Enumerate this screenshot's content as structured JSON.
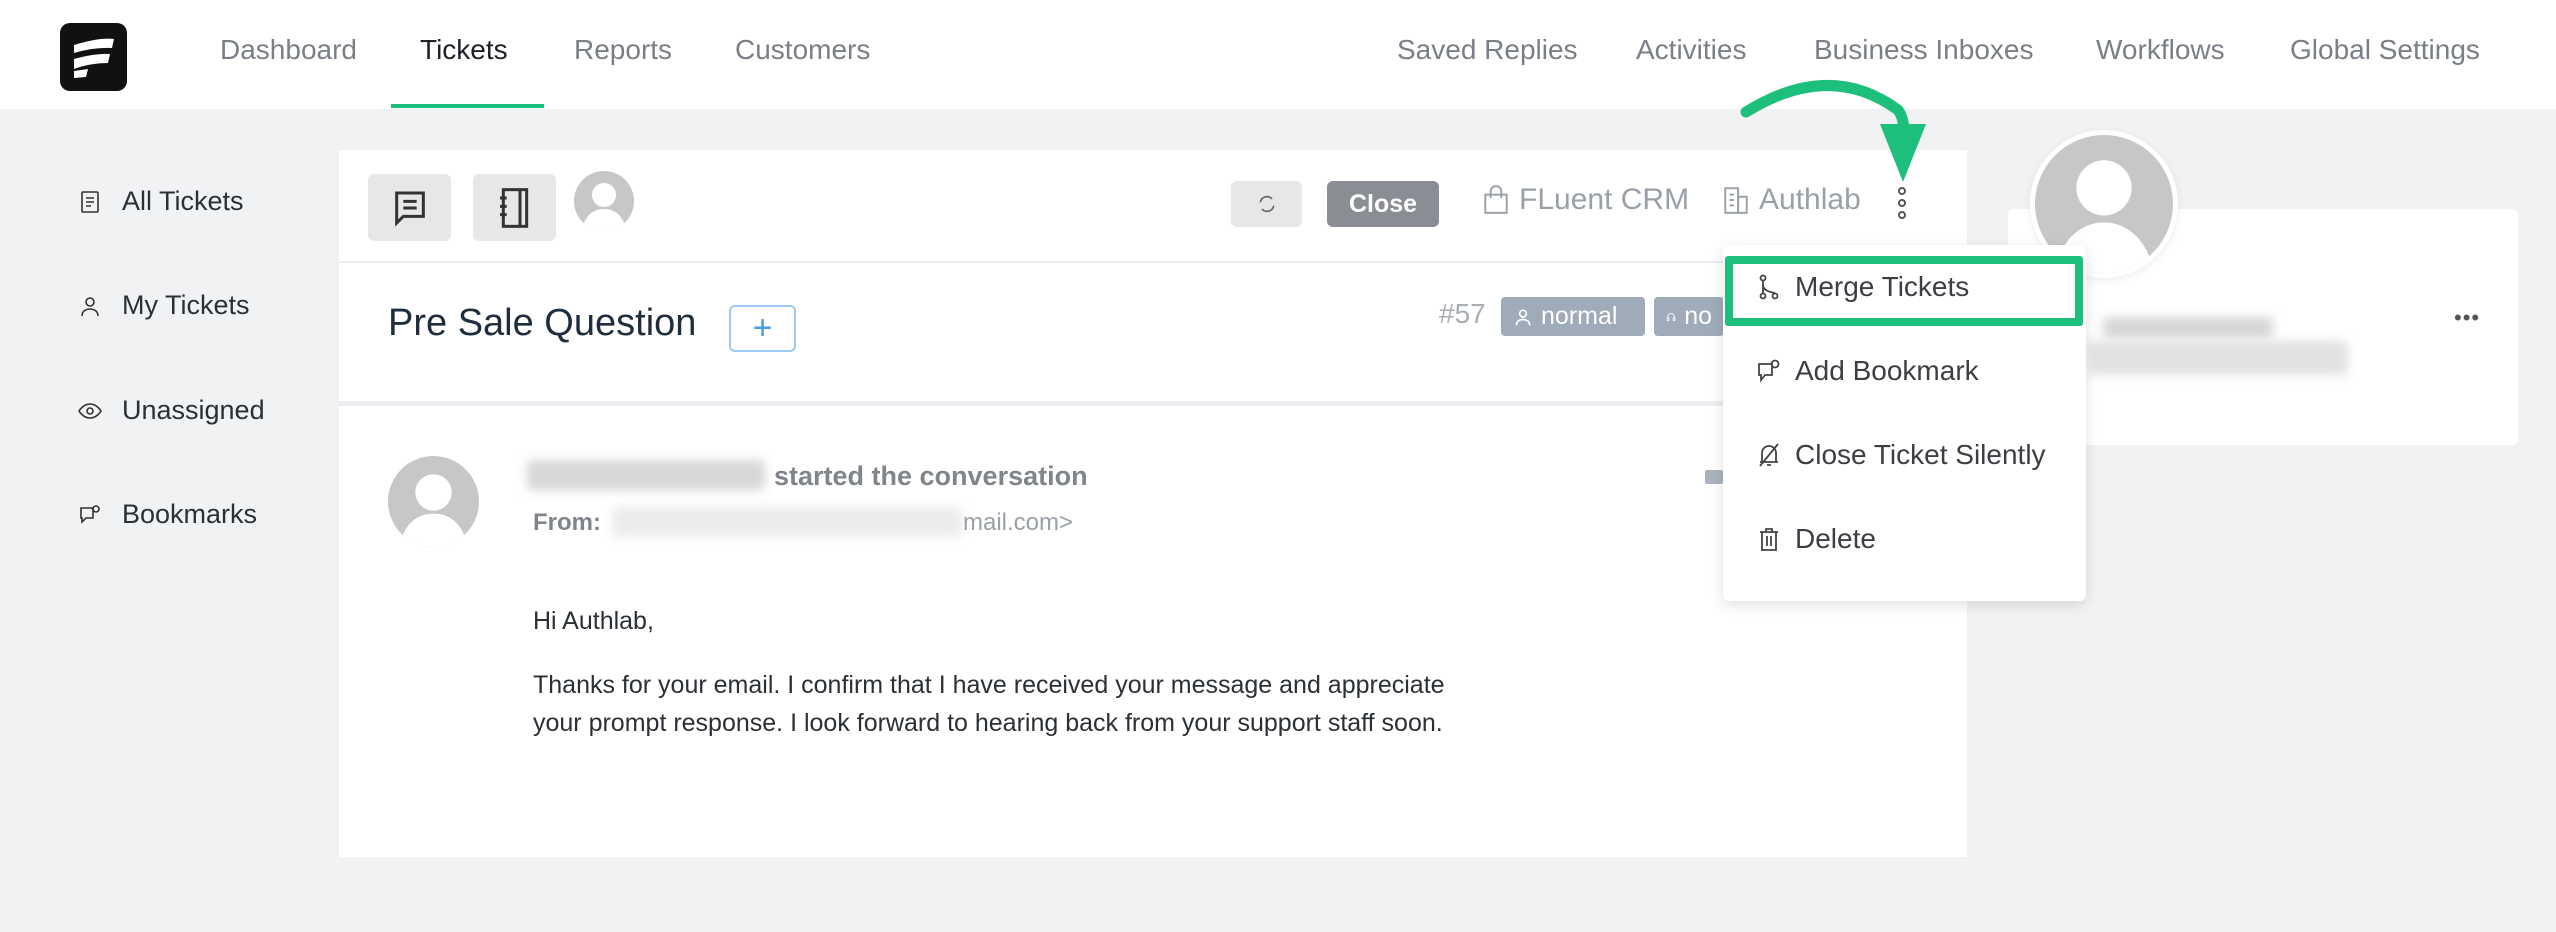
{
  "nav": {
    "left": [
      "Dashboard",
      "Tickets",
      "Reports",
      "Customers"
    ],
    "active": "Tickets",
    "right": [
      "Saved Replies",
      "Activities",
      "Business Inboxes",
      "Workflows",
      "Global Settings"
    ]
  },
  "sidebar": {
    "items": [
      {
        "label": "All Tickets",
        "icon": "document-icon"
      },
      {
        "label": "My Tickets",
        "icon": "user-icon"
      },
      {
        "label": "Unassigned",
        "icon": "eye-icon"
      },
      {
        "label": "Bookmarks",
        "icon": "bookmark-chat-icon"
      }
    ]
  },
  "toolbar": {
    "close_label": "Close",
    "product": "FLuent CRM",
    "business": "Authlab"
  },
  "ticket": {
    "title": "Pre Sale Question",
    "number": "#57",
    "priority": "normal",
    "second_badge": "no"
  },
  "conversation": {
    "action": "started the conversation",
    "from_label": "From:",
    "email_suffix": "mail.com>",
    "greeting": "Hi Authlab,",
    "body": "Thanks for your email. I confirm that I have received your message and appreciate your prompt response. I look forward to hearing back from your support staff soon."
  },
  "menu": {
    "items": [
      "Merge Tickets",
      "Add Bookmark",
      "Close Ticket Silently",
      "Delete"
    ],
    "highlighted": "Merge Tickets"
  },
  "colors": {
    "accent": "#1dbf7c",
    "badge": "#9fabb8",
    "close_button": "#8a8d93"
  }
}
